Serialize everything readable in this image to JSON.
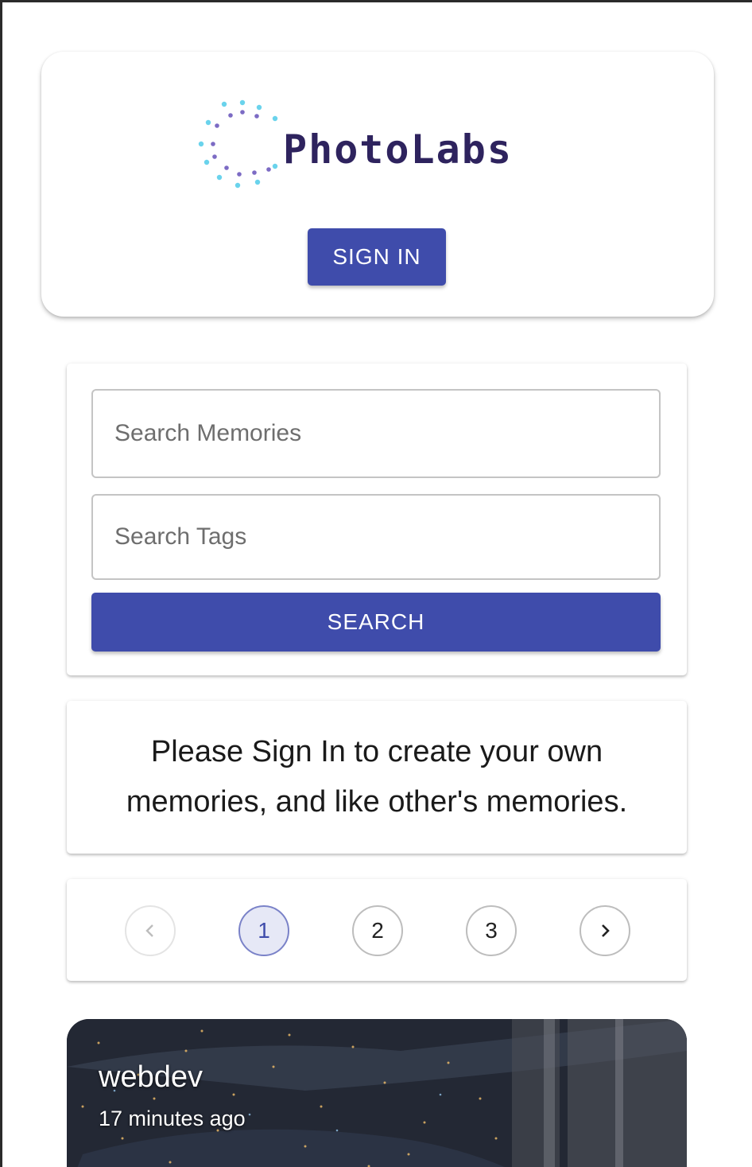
{
  "app": {
    "brand_name": "PhotoLabs",
    "logo_icon": "dotted-ring-logo",
    "sign_in_label": "SIGN IN",
    "accent_color": "#3f4cab"
  },
  "search": {
    "memories_placeholder": "Search Memories",
    "memories_value": "",
    "tags_placeholder": "Search Tags",
    "tags_value": "",
    "button_label": "SEARCH"
  },
  "notice": {
    "text": "Please Sign In to create your own memories, and like other's memories."
  },
  "pagination": {
    "prev_icon": "chevron-left-icon",
    "next_icon": "chevron-right-icon",
    "pages": [
      "1",
      "2",
      "3"
    ],
    "current_page": "1"
  },
  "memories": [
    {
      "creator": "webdev",
      "time": "17 minutes ago"
    }
  ]
}
